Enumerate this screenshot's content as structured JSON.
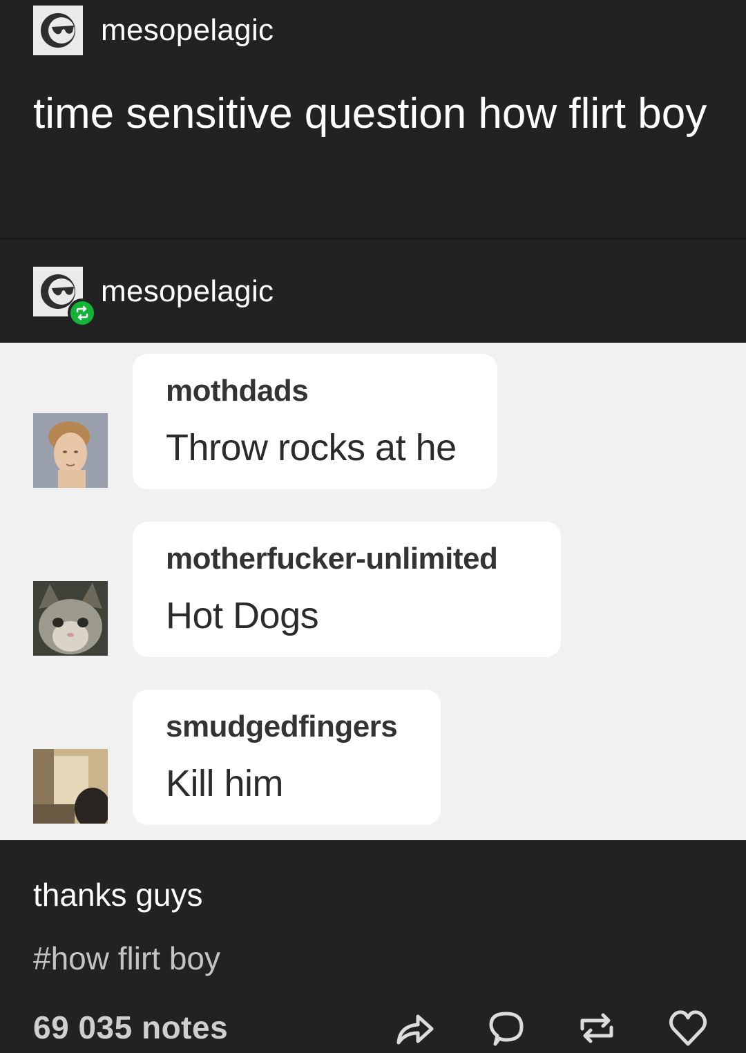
{
  "post": {
    "blog_name": "mesopelagic",
    "text": "time sensitive question how flirt boy"
  },
  "reblog": {
    "blog_name": "mesopelagic"
  },
  "asks": [
    {
      "name": "mothdads",
      "text": "Throw rocks at he"
    },
    {
      "name": "motherfucker-unlimited",
      "text": "Hot Dogs"
    },
    {
      "name": "smudgedfingers",
      "text": "Kill him"
    }
  ],
  "footer": {
    "caption": "thanks guys",
    "tag": "#how flirt boy",
    "notes": "69 035 notes"
  },
  "icons": {
    "share": "share-icon",
    "reply": "reply-icon",
    "reblog": "reblog-icon",
    "like": "heart-icon"
  },
  "colors": {
    "dark_bg": "#222222",
    "ask_bg": "#f1f1f1",
    "bubble_bg": "#ffffff",
    "reblog_badge": "#13b336"
  }
}
